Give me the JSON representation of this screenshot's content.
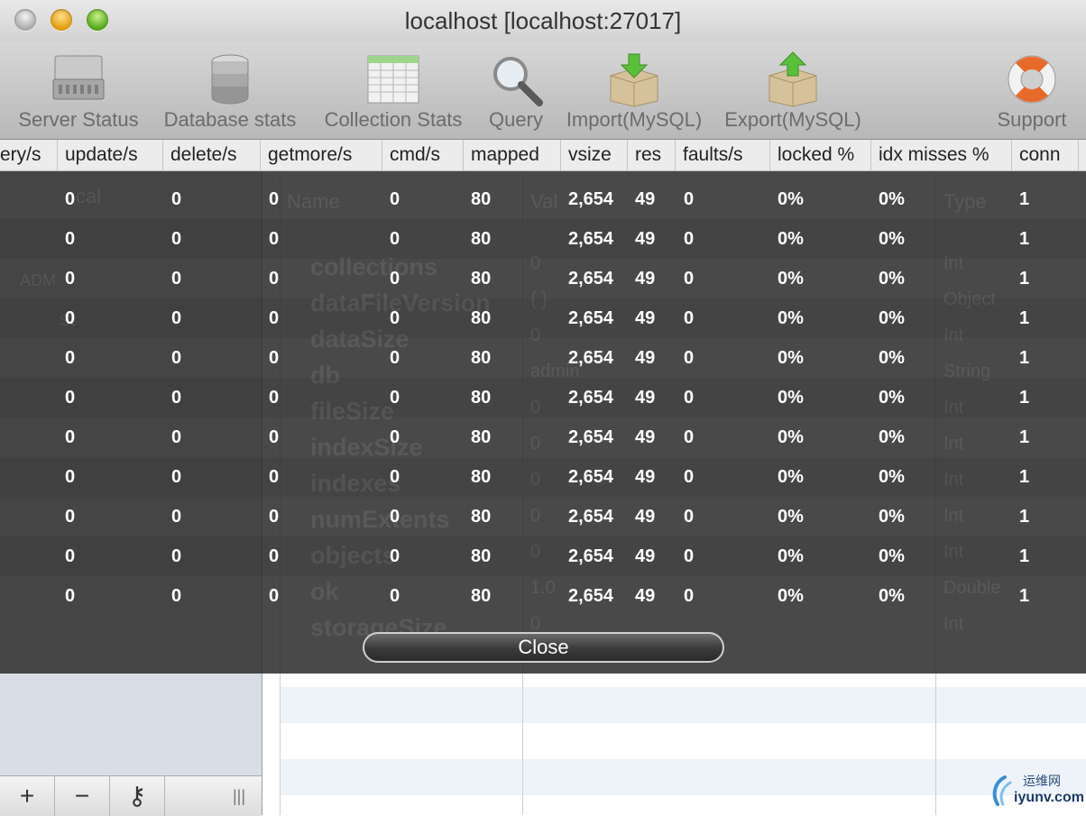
{
  "window": {
    "title": "localhost [localhost:27017]"
  },
  "toolbar": {
    "items": [
      {
        "label": "Server Status",
        "icon": "server-icon"
      },
      {
        "label": "Database stats",
        "icon": "database-icon"
      },
      {
        "label": "Collection Stats",
        "icon": "table-icon"
      },
      {
        "label": "Query",
        "icon": "magnifier-icon"
      },
      {
        "label": "Import(MySQL)",
        "icon": "box-import-icon"
      },
      {
        "label": "Export(MySQL)",
        "icon": "box-export-icon"
      },
      {
        "label": "Support",
        "icon": "lifebuoy-icon"
      }
    ]
  },
  "stats_table": {
    "columns": [
      "ery/s",
      "update/s",
      "delete/s",
      "getmore/s",
      "cmd/s",
      "mapped",
      "vsize",
      "res",
      "faults/s",
      "locked %",
      "idx misses %",
      "conn"
    ],
    "rows": [
      [
        "0",
        "0",
        "0",
        "0",
        "80",
        "2,654",
        "49",
        "0",
        "0%",
        "0%",
        "1"
      ],
      [
        "0",
        "0",
        "0",
        "0",
        "80",
        "2,654",
        "49",
        "0",
        "0%",
        "0%",
        "1"
      ],
      [
        "0",
        "0",
        "0",
        "0",
        "80",
        "2,654",
        "49",
        "0",
        "0%",
        "0%",
        "1"
      ],
      [
        "0",
        "0",
        "0",
        "0",
        "80",
        "2,654",
        "49",
        "0",
        "0%",
        "0%",
        "1"
      ],
      [
        "0",
        "0",
        "0",
        "0",
        "80",
        "2,654",
        "49",
        "0",
        "0%",
        "0%",
        "1"
      ],
      [
        "0",
        "0",
        "0",
        "0",
        "80",
        "2,654",
        "49",
        "0",
        "0%",
        "0%",
        "1"
      ],
      [
        "0",
        "0",
        "0",
        "0",
        "80",
        "2,654",
        "49",
        "0",
        "0%",
        "0%",
        "1"
      ],
      [
        "0",
        "0",
        "0",
        "0",
        "80",
        "2,654",
        "49",
        "0",
        "0%",
        "0%",
        "1"
      ],
      [
        "0",
        "0",
        "0",
        "0",
        "80",
        "2,654",
        "49",
        "0",
        "0%",
        "0%",
        "1"
      ],
      [
        "0",
        "0",
        "0",
        "0",
        "80",
        "2,654",
        "49",
        "0",
        "0%",
        "0%",
        "1"
      ],
      [
        "0",
        "0",
        "0",
        "0",
        "80",
        "2,654",
        "49",
        "0",
        "0%",
        "0%",
        "1"
      ]
    ]
  },
  "close_button": {
    "label": "Close"
  },
  "background": {
    "sidebar_items": [
      "cal",
      "st"
    ],
    "sidebar_section": "ADM",
    "columns": [
      "Name",
      "Val",
      "Type"
    ],
    "names": [
      "collections",
      "dataFileVersion",
      "dataSize",
      "db",
      "fileSize",
      "indexSize",
      "indexes",
      "numExtents",
      "objects",
      "ok",
      "storageSize"
    ],
    "values": [
      "0",
      "{ }",
      "0",
      "admin",
      "0",
      "0",
      "0",
      "0",
      "0",
      "1.0",
      "0"
    ],
    "types": [
      "Int",
      "Object",
      "Int",
      "String",
      "Int",
      "Int",
      "Int",
      "Int",
      "Int",
      "Double",
      "Int"
    ]
  },
  "sidebar_bottom": {
    "add": "+",
    "remove": "−",
    "key": "⚷",
    "grip": "|||"
  },
  "watermark": {
    "top": "运维网",
    "bottom": "iyunv.com"
  }
}
